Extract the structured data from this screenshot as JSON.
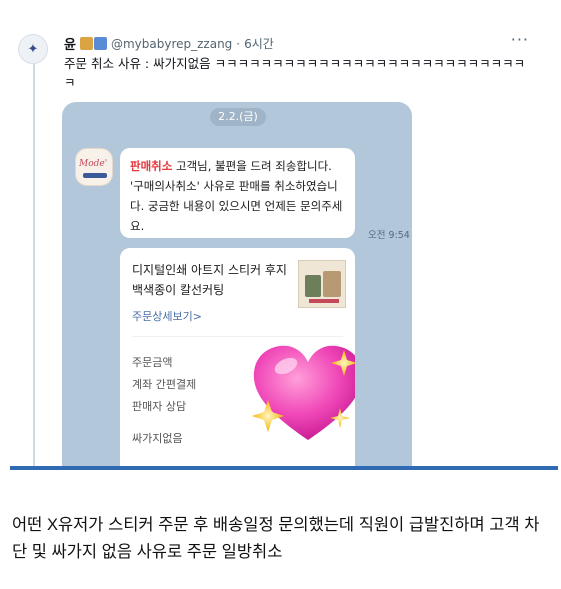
{
  "tweet": {
    "display_name": "윤",
    "handle": "@mybabyrep_zzang",
    "separator_dot": "·",
    "time": "6시간",
    "text": "주문 취소 사유 : 싸가지없음 ㅋㅋㅋㅋㅋㅋㅋㅋㅋㅋㅋㅋㅋㅋㅋㅋㅋㅋㅋㅋㅋㅋㅋㅋㅋㅋㅋㅋ",
    "more_icon": "more-dots-icon"
  },
  "chat": {
    "date": "2.2.(금)",
    "message_highlight": "판매취소",
    "message_body": " 고객님, 불편을 드려 죄송합니다. '구매의사취소' 사유로 판매를 취소하였습니다. 궁금한 내용이 있으시면 언제든 문의주세요.",
    "time": "오전 9:54",
    "card": {
      "product_title": "디지털인쇄 아트지 스티커 후지백색종이 칼선커팅",
      "detail_link": "주문상세보기>",
      "items": [
        "주문금액",
        "계좌 간편결제",
        "판매자 상담",
        "싸가지없음"
      ]
    },
    "overlay_sticker": "sparkling-heart-sticker"
  },
  "caption": "어떤 X유저가 스티커 주문 후 배송일정 문의했는데 직원이 급발진하며 고객 차단 및 싸가지 없음 사유로 주문 일방취소",
  "colors": {
    "chat_bg": "#b2c7d9",
    "cancel_red": "#e5383b",
    "link_blue": "#4a6fa5",
    "separator": "#2f6ab3"
  }
}
